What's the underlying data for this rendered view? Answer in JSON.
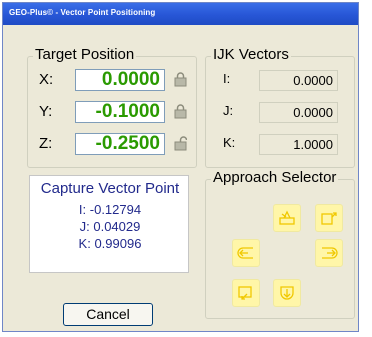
{
  "window": {
    "title": "GEO-Plus© - Vector Point Positioning"
  },
  "target_position": {
    "label": "Target Position",
    "rows": [
      {
        "axis": "X:",
        "value": "0.0000",
        "lock": "locked"
      },
      {
        "axis": "Y:",
        "value": "-0.1000",
        "lock": "locked"
      },
      {
        "axis": "Z:",
        "value": "-0.2500",
        "lock": "unlocked"
      }
    ],
    "value_color": "#2a9a00"
  },
  "ijk_vectors": {
    "label": "IJK Vectors",
    "rows": [
      {
        "axis": "I:",
        "value": "0.0000"
      },
      {
        "axis": "J:",
        "value": "0.0000"
      },
      {
        "axis": "K:",
        "value": "1.0000"
      }
    ]
  },
  "capture": {
    "title": "Capture Vector Point",
    "lines": [
      "I: -0.12794",
      "J: 0.04029",
      "K: 0.99096"
    ],
    "text_color": "#222a8c"
  },
  "approach_selector": {
    "label": "Approach Selector",
    "buttons": [
      "approach-top-left-icon",
      "approach-top-right-icon",
      "approach-left-icon",
      "approach-right-icon",
      "approach-bottom-left-icon",
      "approach-bottom-icon"
    ],
    "button_color": "#fff6a8"
  },
  "cancel_label": "Cancel"
}
